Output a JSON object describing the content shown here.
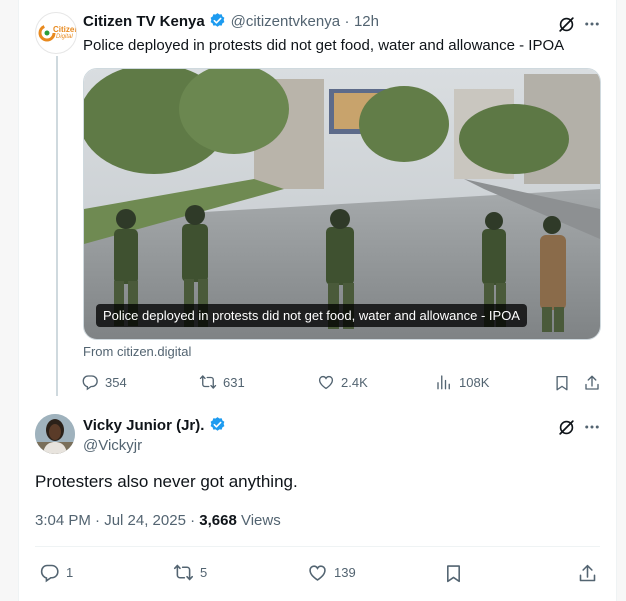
{
  "tweet1": {
    "author_name": "Citizen TV Kenya",
    "handle": "@citizentvkenya",
    "separator": "·",
    "time": "12h",
    "avatar_text": "Citizen",
    "avatar_subtext": "Digital",
    "text": "Police deployed in protests did not get food, water and allowance - IPOA",
    "media_caption": "Police deployed in protests did not get food, water and allowance - IPOA",
    "link_source": "From citizen.digital",
    "stats": {
      "replies": "354",
      "reposts": "631",
      "likes": "2.4K",
      "views": "108K"
    }
  },
  "tweet2": {
    "author_name": "Vicky Junior (Jr).",
    "handle": "@Vickyjr",
    "text": "Protesters also never got anything.",
    "timestamp": "3:04 PM · Jul 24, 2025 · ",
    "views_count": "3,668",
    "views_label": " Views",
    "stats": {
      "replies": "1",
      "reposts": "5",
      "likes": "139"
    }
  },
  "colors": {
    "verified": "#1d9bf0",
    "muted": "#536471",
    "text": "#0f1419",
    "grok": "#0f1419"
  },
  "icons": [
    "verified-badge-icon",
    "grok-icon",
    "more-icon",
    "reply-icon",
    "repost-icon",
    "like-icon",
    "views-icon",
    "bookmark-icon",
    "share-icon"
  ]
}
